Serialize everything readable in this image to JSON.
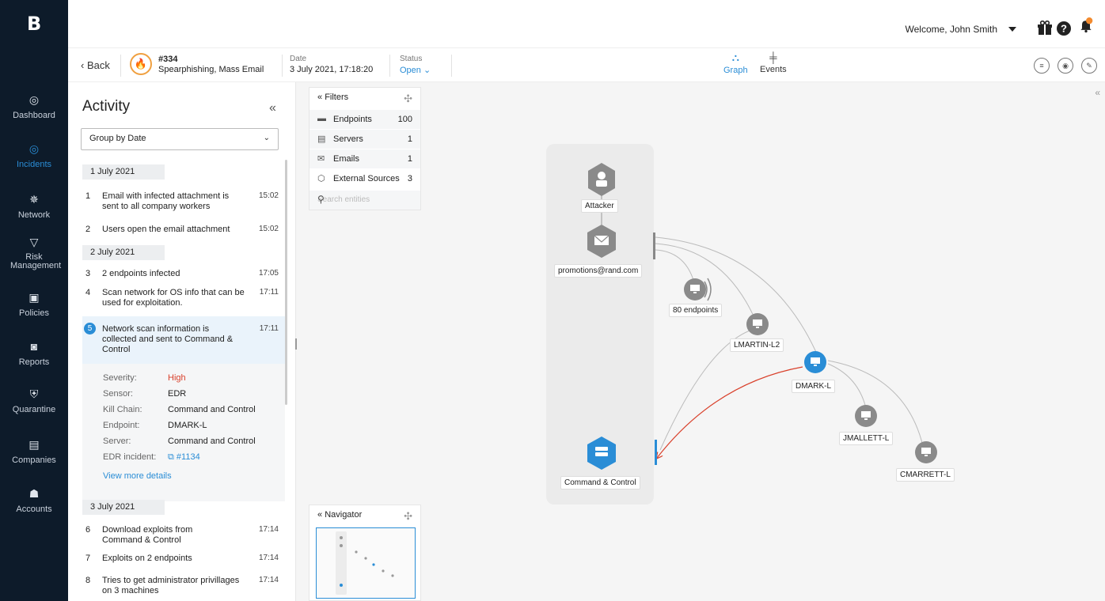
{
  "brand": {
    "logo": "B"
  },
  "nav": {
    "items": [
      {
        "label": "Dashboard",
        "icon": "target-icon"
      },
      {
        "label": "Incidents",
        "icon": "incidents-icon",
        "active": true
      },
      {
        "label": "Network",
        "icon": "network-icon"
      },
      {
        "label": "Risk Management",
        "icon": "risk-icon"
      },
      {
        "label": "Policies",
        "icon": "policies-icon"
      },
      {
        "label": "Reports",
        "icon": "reports-icon"
      },
      {
        "label": "Quarantine",
        "icon": "shield-icon"
      },
      {
        "label": "Companies",
        "icon": "briefcase-icon"
      },
      {
        "label": "Accounts",
        "icon": "users-icon"
      }
    ]
  },
  "header": {
    "welcome": "Welcome,  John Smith",
    "icons": [
      "gift-icon",
      "help-icon",
      "bell-icon"
    ]
  },
  "incident": {
    "back_label": "Back",
    "number": "#334",
    "name": "Spearphishing, Mass Email",
    "date_label": "Date",
    "date_value": "3 July 2021, 17:18:20",
    "status_label": "Status",
    "status_value": "Open",
    "tabs": [
      {
        "label": "Graph",
        "active": true
      },
      {
        "label": "Events",
        "active": false
      }
    ]
  },
  "activity": {
    "title": "Activity",
    "group_by": "Group by Date",
    "days": [
      {
        "label": "1 July 2021"
      },
      {
        "label": "2 July 2021"
      },
      {
        "label": "3 July 2021"
      }
    ],
    "events": [
      {
        "n": "1",
        "text": "Email with infected attachment is sent to all company workers",
        "time": "15:02"
      },
      {
        "n": "2",
        "text": "Users open the email attachment",
        "time": "15:02"
      },
      {
        "n": "3",
        "text": "2 endpoints infected",
        "time": "17:05"
      },
      {
        "n": "4",
        "text": "Scan network for OS info that can be used for exploitation.",
        "time": "17:11"
      },
      {
        "n": "5",
        "text": "Network scan information is collected and sent to Command & Control",
        "time": "17:11"
      },
      {
        "n": "6",
        "text": "Download exploits from Command & Control",
        "time": "17:14"
      },
      {
        "n": "7",
        "text": "Exploits on 2 endpoints",
        "time": "17:14"
      },
      {
        "n": "8",
        "text": "Tries to get administrator privillages on 3 machines",
        "time": "17:14"
      }
    ],
    "details": {
      "severity_k": "Severity:",
      "severity_v": "High",
      "sensor_k": "Sensor:",
      "sensor_v": "EDR",
      "kill_k": "Kill Chain:",
      "kill_v": "Command and Control",
      "endpoint_k": "Endpoint:",
      "endpoint_v": "DMARK-L",
      "server_k": "Server:",
      "server_v": "Command and Control",
      "edr_k": "EDR incident:",
      "edr_v": "#1134",
      "more": "View more details"
    }
  },
  "filters": {
    "title": "Filters",
    "rows": [
      {
        "label": "Endpoints",
        "count": "100"
      },
      {
        "label": "Servers",
        "count": "1"
      },
      {
        "label": "Emails",
        "count": "1"
      },
      {
        "label": "External Sources",
        "count": "3"
      }
    ],
    "search_placeholder": "Search entities"
  },
  "navigator": {
    "title": "Navigator"
  },
  "graph": {
    "nodes": {
      "attacker": "Attacker",
      "email": "promotions@rand.com",
      "endpoints": "80 endpoints",
      "lmartin": "LMARTIN-L2",
      "dmark": "DMARK-L",
      "jmallett": "JMALLETT-L",
      "cmarrett": "CMARRETT-L",
      "cc": "Command & Control"
    },
    "colors": {
      "primary": "#2a8dd6",
      "node_gray": "#8a8a8a",
      "danger": "#d9402b"
    }
  }
}
